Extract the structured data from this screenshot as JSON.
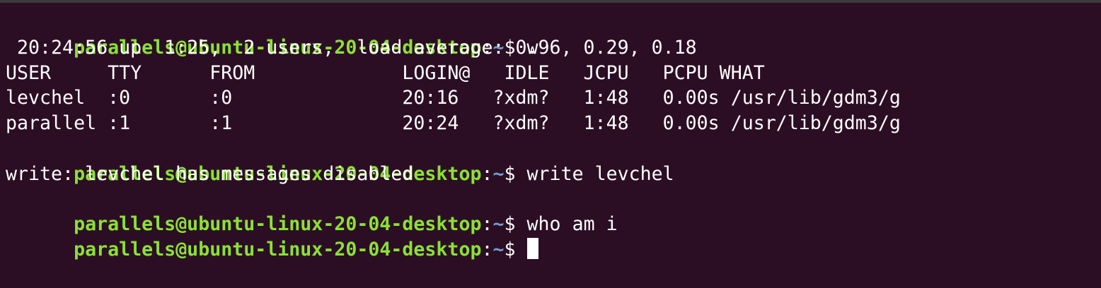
{
  "colors": {
    "background": "#2c0e24",
    "prompt_user": "#8ae234",
    "prompt_path": "#729fcf",
    "text": "#ffffff"
  },
  "prompt": {
    "user_host": "parallels@ubuntu-linux-20-04-desktop",
    "separator": ":",
    "path": "~",
    "symbol": "$ "
  },
  "lines": {
    "cmd1": "w",
    "out_uptime": " 20:24:56 up  1:25,  2 users,  load average: 0.96, 0.29, 0.18",
    "out_header": "USER     TTY      FROM             LOGIN@   IDLE   JCPU   PCPU WHAT",
    "out_row1": "levchel  :0       :0               20:16   ?xdm?   1:48   0.00s /usr/lib/gdm3/g",
    "out_row2": "parallel :1       :1               20:24   ?xdm?   1:48   0.00s /usr/lib/gdm3/g",
    "cmd2": "write levchel",
    "out_write": "write: levchel has messages disabled",
    "cmd3": "who am i",
    "cmd4": ""
  }
}
